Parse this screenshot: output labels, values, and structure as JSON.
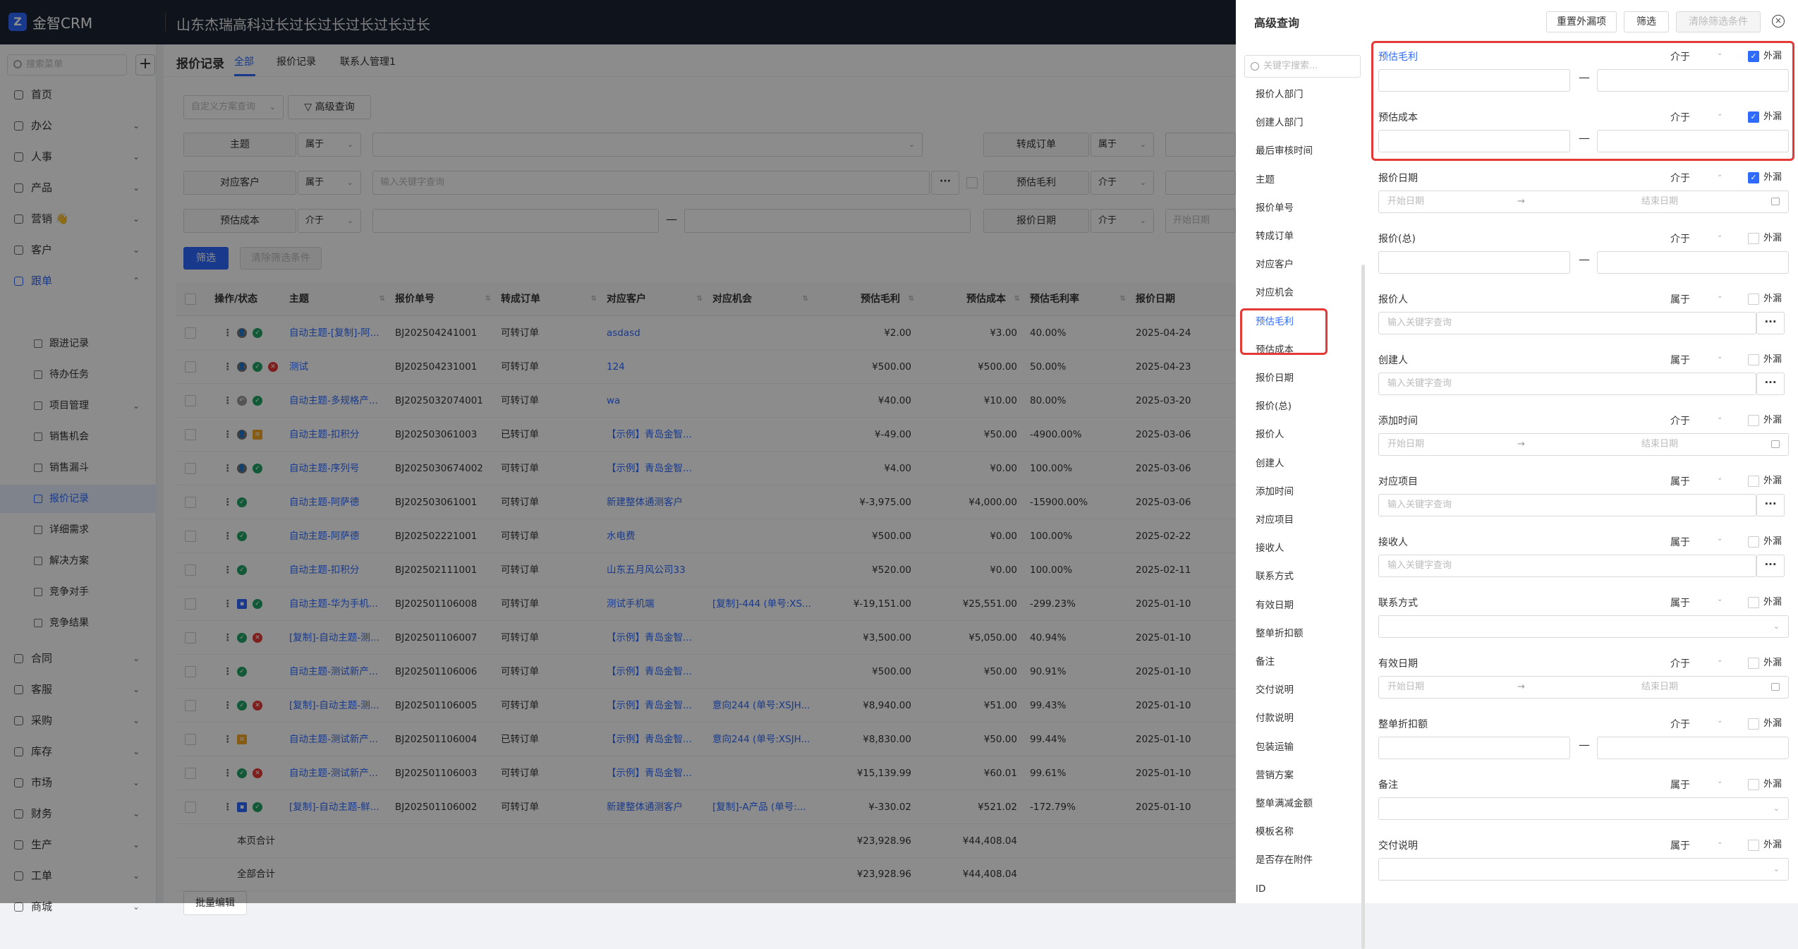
{
  "app": {
    "logo_letter": "Z",
    "name": "金智CRM",
    "company": "山东杰瑞高科过长过长过长过长过长过长"
  },
  "sidebar": {
    "search_placeholder": "搜索菜单",
    "add": "+",
    "items": [
      {
        "label": "首页",
        "chev": ""
      },
      {
        "label": "办公",
        "chev": "⌄"
      },
      {
        "label": "人事",
        "chev": "⌄"
      },
      {
        "label": "产品",
        "chev": "⌄"
      },
      {
        "label": "营销 👋",
        "chev": "⌄"
      },
      {
        "label": "客户",
        "chev": "⌄"
      },
      {
        "label": "跟单",
        "chev": "⌃"
      }
    ],
    "sub_items": [
      {
        "label": "跟进记录",
        "chev": ""
      },
      {
        "label": "待办任务",
        "chev": ""
      },
      {
        "label": "项目管理",
        "chev": "⌄"
      },
      {
        "label": "销售机会",
        "chev": ""
      },
      {
        "label": "销售漏斗",
        "chev": ""
      },
      {
        "label": "报价记录",
        "chev": ""
      },
      {
        "label": "详细需求",
        "chev": ""
      },
      {
        "label": "解决方案",
        "chev": ""
      },
      {
        "label": "竞争对手",
        "chev": ""
      },
      {
        "label": "竞争结果",
        "chev": ""
      }
    ],
    "items2": [
      {
        "label": "合同",
        "chev": "⌄"
      },
      {
        "label": "客服",
        "chev": "⌄"
      },
      {
        "label": "采购",
        "chev": "⌄"
      },
      {
        "label": "库存",
        "chev": "⌄"
      },
      {
        "label": "市场",
        "chev": "⌄"
      },
      {
        "label": "财务",
        "chev": "⌄"
      },
      {
        "label": "生产",
        "chev": "⌄"
      },
      {
        "label": "工单",
        "chev": "⌄"
      },
      {
        "label": "商城",
        "chev": "⌄"
      }
    ]
  },
  "main": {
    "title": "报价记录",
    "tabs": [
      "全部",
      "报价记录",
      "联系人管理1"
    ],
    "scheme_placeholder": "自定义方案查询",
    "advanced_btn": "高级查询",
    "filter_rows": [
      {
        "label": "主题",
        "op": "属于",
        "right_label": "转成订单",
        "right_op": "属于"
      },
      {
        "label": "对应客户",
        "op": "属于",
        "input_placeholder": "输入关键字查询",
        "more": "···",
        "right_label": "预估毛利",
        "right_op": "介于"
      },
      {
        "label": "预估成本",
        "op": "介于",
        "dash": "—",
        "right_label": "报价日期",
        "right_op": "介于",
        "right_placeholder": "开始日期"
      }
    ],
    "filter_btn": "筛选",
    "clear_btn": "清除筛选条件",
    "batch_btn": "批量编辑",
    "sort_icon": "⇅",
    "columns": [
      "操作/状态",
      "主题",
      "报价单号",
      "转成订单",
      "对应客户",
      "对应机会",
      "预估毛利",
      "预估成本",
      "预估毛利率",
      "报价日期"
    ],
    "rows": [
      {
        "subject": "自动主题-[复制]-阿...",
        "no": "BJ202504241001",
        "order": "可转订单",
        "customer": "asdasd",
        "opp": "",
        "profit": "¥2.00",
        "cost": "¥3.00",
        "rate": "40.00%",
        "date": "2025-04-24",
        "icons": [
          "user",
          "ok"
        ]
      },
      {
        "subject": "测试",
        "no": "BJ202504231001",
        "order": "可转订单",
        "customer": "124",
        "opp": "",
        "profit": "¥500.00",
        "cost": "¥500.00",
        "rate": "50.00%",
        "date": "2025-04-23",
        "icons": [
          "user",
          "ok",
          "no"
        ]
      },
      {
        "subject": "自动主题-多规格产...",
        "no": "BJ2025032074001",
        "order": "可转订单",
        "customer": "wa",
        "opp": "",
        "profit": "¥40.00",
        "cost": "¥10.00",
        "rate": "80.00%",
        "date": "2025-03-20",
        "icons": [
          "back",
          "ok"
        ]
      },
      {
        "subject": "自动主题-扣积分",
        "no": "BJ202503061003",
        "order": "已转订单",
        "customer": "【示例】青岛金智...",
        "opp": "",
        "profit": "¥-49.00",
        "cost": "¥50.00",
        "rate": "-4900.00%",
        "date": "2025-03-06",
        "icons": [
          "user",
          "doc"
        ]
      },
      {
        "subject": "自动主题-序列号",
        "no": "BJ2025030674002",
        "order": "可转订单",
        "customer": "【示例】青岛金智...",
        "opp": "",
        "profit": "¥4.00",
        "cost": "¥0.00",
        "rate": "100.00%",
        "date": "2025-03-06",
        "icons": [
          "user",
          "ok"
        ]
      },
      {
        "subject": "自动主题-阿萨德",
        "no": "BJ202503061001",
        "order": "可转订单",
        "customer": "新建整体通测客户",
        "opp": "",
        "profit": "¥-3,975.00",
        "cost": "¥4,000.00",
        "rate": "-15900.00%",
        "date": "2025-03-06",
        "icons": [
          "ok"
        ]
      },
      {
        "subject": "自动主题-阿萨德",
        "no": "BJ202502221001",
        "order": "可转订单",
        "customer": "水电费",
        "opp": "",
        "profit": "¥500.00",
        "cost": "¥0.00",
        "rate": "100.00%",
        "date": "2025-02-22",
        "icons": [
          "ok"
        ]
      },
      {
        "subject": "自动主题-扣积分",
        "no": "BJ202502111001",
        "order": "可转订单",
        "customer": "山东五月风公司33",
        "opp": "",
        "profit": "¥520.00",
        "cost": "¥0.00",
        "rate": "100.00%",
        "date": "2025-02-11",
        "icons": [
          "ok"
        ]
      },
      {
        "subject": "自动主题-华为手机...",
        "no": "BJ202501106008",
        "order": "可转订单",
        "customer": "测试手机端",
        "opp": "[复制]-444 (单号:XS...",
        "profit": "¥-19,151.00",
        "cost": "¥25,551.00",
        "rate": "-299.23%",
        "date": "2025-01-10",
        "icons": [
          "blue",
          "ok"
        ]
      },
      {
        "subject": "[复制]-自动主题-测...",
        "no": "BJ202501106007",
        "order": "可转订单",
        "customer": "【示例】青岛金智...",
        "opp": "",
        "profit": "¥3,500.00",
        "cost": "¥5,050.00",
        "rate": "40.94%",
        "date": "2025-01-10",
        "icons": [
          "ok",
          "no"
        ]
      },
      {
        "subject": "自动主题-测试新产...",
        "no": "BJ202501106006",
        "order": "可转订单",
        "customer": "【示例】青岛金智...",
        "opp": "",
        "profit": "¥500.00",
        "cost": "¥50.00",
        "rate": "90.91%",
        "date": "2025-01-10",
        "icons": [
          "ok"
        ]
      },
      {
        "subject": "[复制]-自动主题-测...",
        "no": "BJ202501106005",
        "order": "可转订单",
        "customer": "【示例】青岛金智...",
        "opp": "意向244 (单号:XSJH...",
        "profit": "¥8,940.00",
        "cost": "¥51.00",
        "rate": "99.43%",
        "date": "2025-01-10",
        "icons": [
          "ok",
          "no"
        ]
      },
      {
        "subject": "自动主题-测试新产...",
        "no": "BJ202501106004",
        "order": "已转订单",
        "customer": "【示例】青岛金智...",
        "opp": "意向244 (单号:XSJH...",
        "profit": "¥8,830.00",
        "cost": "¥50.00",
        "rate": "99.44%",
        "date": "2025-01-10",
        "icons": [
          "doc"
        ]
      },
      {
        "subject": "自动主题-测试新产...",
        "no": "BJ202501106003",
        "order": "可转订单",
        "customer": "【示例】青岛金智...",
        "opp": "",
        "profit": "¥15,139.99",
        "cost": "¥60.01",
        "rate": "99.61%",
        "date": "2025-01-10",
        "icons": [
          "ok",
          "no"
        ]
      },
      {
        "subject": "[复制]-自动主题-鲜...",
        "no": "BJ202501106002",
        "order": "可转订单",
        "customer": "新建整体通测客户",
        "opp": "[复制]-A产品 (单号:...",
        "profit": "¥-330.02",
        "cost": "¥521.02",
        "rate": "-172.79%",
        "date": "2025-01-10",
        "icons": [
          "blue",
          "ok"
        ]
      }
    ],
    "totals": [
      {
        "label": "本页合计",
        "profit": "¥23,928.96",
        "cost": "¥44,408.04"
      },
      {
        "label": "全部合计",
        "profit": "¥23,928.96",
        "cost": "¥44,408.04"
      }
    ]
  },
  "drawer": {
    "title": "高级查询",
    "reset_btn": "重置外漏项",
    "filter_btn": "筛选",
    "clear_btn": "清除筛选条件",
    "close": "×",
    "search_placeholder": "关键字搜索...",
    "fields": [
      "报价人部门",
      "创建人部门",
      "最后审核时间",
      "主题",
      "报价单号",
      "转成订单",
      "对应客户",
      "对应机会",
      "预估毛利",
      "预估成本",
      "报价日期",
      "报价(总)",
      "报价人",
      "创建人",
      "添加时间",
      "对应项目",
      "接收人",
      "联系方式",
      "有效日期",
      "整单折扣额",
      "备注",
      "交付说明",
      "付款说明",
      "包装运输",
      "营销方案",
      "整单满减金额",
      "模板名称",
      "是否存在附件",
      "ID"
    ],
    "expose_label": "外漏",
    "dash": "—",
    "arrow": "→",
    "start_date": "开始日期",
    "end_date": "结束日期",
    "kw_placeholder": "输入关键字查询",
    "more": "···",
    "check": "✓",
    "panels": [
      {
        "label": "预估毛利",
        "op": "介于",
        "checked": true,
        "type": "range"
      },
      {
        "label": "预估成本",
        "op": "介于",
        "checked": true,
        "type": "range"
      },
      {
        "label": "报价日期",
        "op": "介于",
        "checked": true,
        "type": "date"
      },
      {
        "label": "报价(总)",
        "op": "介于",
        "checked": false,
        "type": "range"
      },
      {
        "label": "报价人",
        "op": "属于",
        "checked": false,
        "type": "kw"
      },
      {
        "label": "创建人",
        "op": "属于",
        "checked": false,
        "type": "kw"
      },
      {
        "label": "添加时间",
        "op": "介于",
        "checked": false,
        "type": "date"
      },
      {
        "label": "对应项目",
        "op": "属于",
        "checked": false,
        "type": "kw"
      },
      {
        "label": "接收人",
        "op": "属于",
        "checked": false,
        "type": "kw"
      },
      {
        "label": "联系方式",
        "op": "属于",
        "checked": false,
        "type": "select"
      },
      {
        "label": "有效日期",
        "op": "介于",
        "checked": false,
        "type": "date"
      },
      {
        "label": "整单折扣额",
        "op": "介于",
        "checked": false,
        "type": "range"
      },
      {
        "label": "备注",
        "op": "属于",
        "checked": false,
        "type": "select"
      },
      {
        "label": "交付说明",
        "op": "属于",
        "checked": false,
        "type": "select"
      }
    ]
  }
}
